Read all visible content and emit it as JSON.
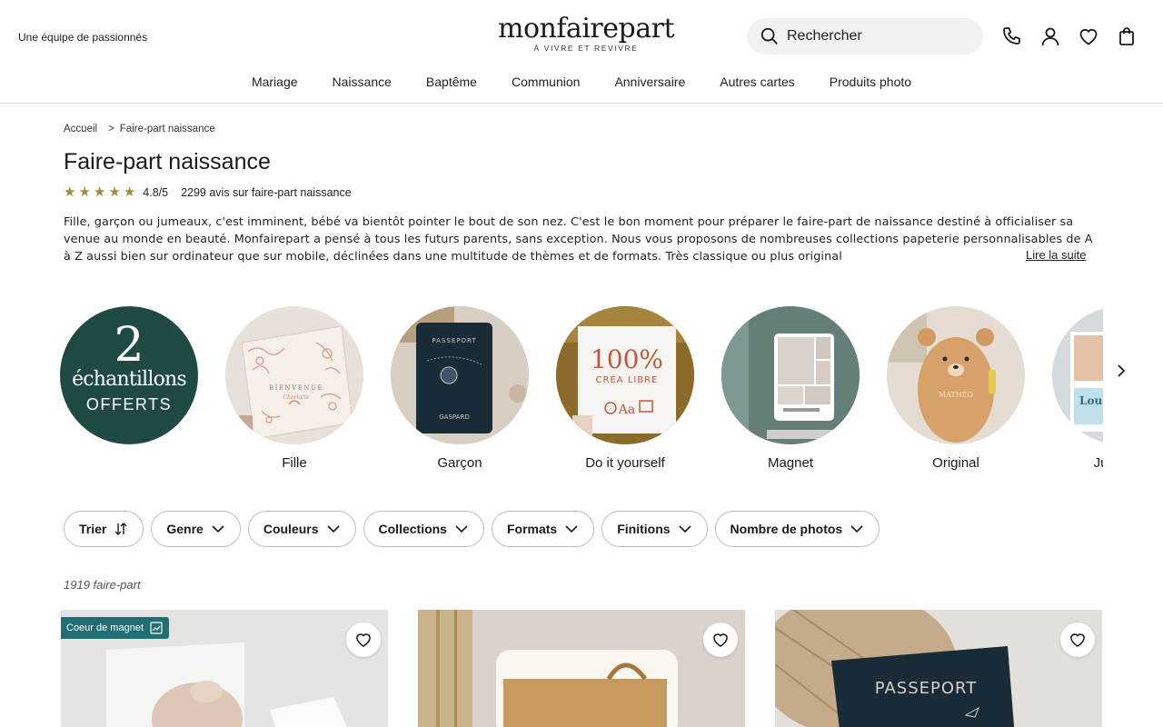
{
  "header": {
    "tagline": "Une équipe de passionnés",
    "logo_main": "monfairepart",
    "logo_sub": "À VIVRE ET REVIVRE",
    "search_label": "Rechercher",
    "icons": [
      "phone-icon",
      "account-icon",
      "heart-icon",
      "bag-icon"
    ]
  },
  "nav": [
    "Mariage",
    "Naissance",
    "Baptême",
    "Communion",
    "Anniversaire",
    "Autres cartes",
    "Produits photo"
  ],
  "breadcrumb": {
    "home": "Accueil",
    "sep": ">",
    "current": "Faire-part naissance"
  },
  "page": {
    "title": "Faire-part naissance",
    "score": "4.8/5",
    "reviews": "2299 avis sur faire-part naissance",
    "description": "Fille, garçon ou jumeaux, c'est imminent, bébé va bientôt pointer le bout de son nez. C'est le bon moment pour préparer le faire-part de naissance destiné à officialiser sa venue au monde en beauté. Monfairepart a pensé à tous les futurs parents, sans exception. Nous vous proposons de nombreuses collections papeterie personnalisables de A à Z aussi bien sur ordinateur que sur mobile, déclinées dans une multitude de thèmes et de formats. Très classique ou plus original",
    "read_more": "Lire la suite"
  },
  "promo": {
    "number": "2",
    "word": "échantillons",
    "offer": "OFFERTS"
  },
  "categories": [
    {
      "label": "Fille",
      "card_text": "BIENVENUE"
    },
    {
      "label": "Garçon",
      "card_top": "PASSEPORT",
      "card_name": "GASPARD"
    },
    {
      "label": "Do it yourself",
      "card_big": "100%",
      "card_sub": "CRÉA LIBRE",
      "card_aa": "Aa"
    },
    {
      "label": "Magnet"
    },
    {
      "label": "Original"
    },
    {
      "label": "Jumeaux"
    }
  ],
  "filters": [
    "Trier",
    "Genre",
    "Couleurs",
    "Collections",
    "Formats",
    "Finitions",
    "Nombre de photos"
  ],
  "results_count": "1919 faire-part",
  "products": [
    {
      "badge": "Coeur de magnet"
    },
    {},
    {
      "card_text": "PASSEPORT"
    }
  ],
  "colors": {
    "accent_dark": "#1f4a44",
    "badge": "#1f6f73",
    "star": "#a08a3c"
  }
}
